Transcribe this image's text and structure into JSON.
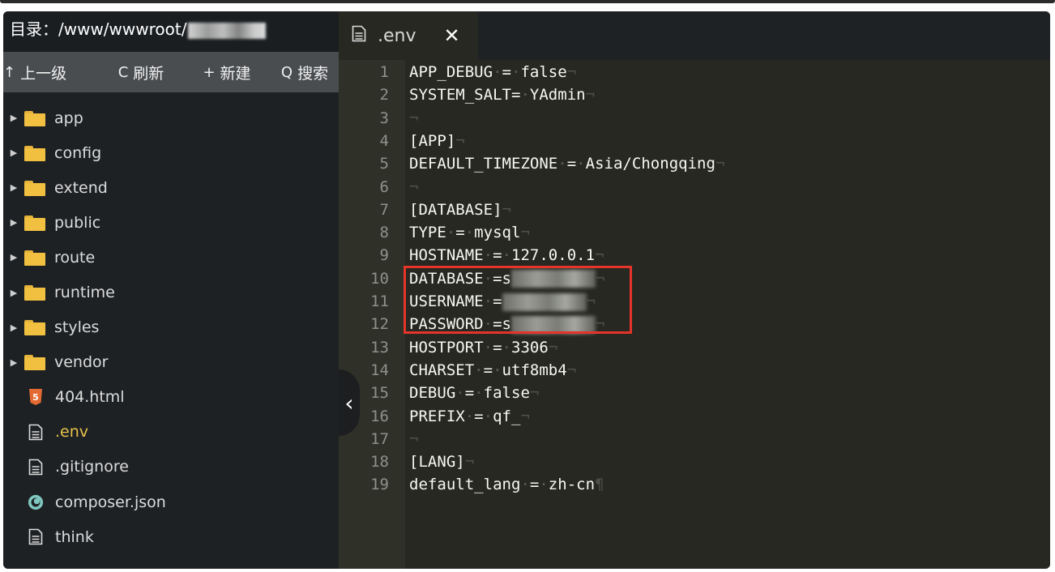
{
  "sidebar": {
    "directory_label": "目录：/www/wwwroot/",
    "toolbar": [
      {
        "icon": "arrow-up-icon",
        "glyph": "↑",
        "label": "上一级"
      },
      {
        "icon": "refresh-icon",
        "glyph": "C",
        "label": "刷新"
      },
      {
        "icon": "plus-icon",
        "glyph": "+",
        "label": "新建"
      },
      {
        "icon": "search-icon",
        "glyph": "Q",
        "label": "搜索"
      }
    ],
    "tree": {
      "folders": [
        "app",
        "config",
        "extend",
        "public",
        "route",
        "runtime",
        "styles",
        "vendor"
      ],
      "files": [
        {
          "name": "404.html",
          "icon": "html5-icon"
        },
        {
          "name": ".env",
          "icon": "document-icon",
          "active": true
        },
        {
          "name": ".gitignore",
          "icon": "document-icon"
        },
        {
          "name": "composer.json",
          "icon": "composer-icon"
        },
        {
          "name": "think",
          "icon": "document-icon"
        }
      ]
    }
  },
  "editor": {
    "tab": {
      "label": ".env",
      "close": "✕"
    },
    "lines": [
      {
        "n": "1",
        "text": "APP_DEBUG = false"
      },
      {
        "n": "2",
        "text": "SYSTEM_SALT= YAdmin"
      },
      {
        "n": "3",
        "text": ""
      },
      {
        "n": "4",
        "text": "[APP]"
      },
      {
        "n": "5",
        "text": "DEFAULT_TIMEZONE = Asia/Chongqing"
      },
      {
        "n": "6",
        "text": ""
      },
      {
        "n": "7",
        "text": "[DATABASE]"
      },
      {
        "n": "8",
        "text": "TYPE = mysql"
      },
      {
        "n": "9",
        "text": "HOSTNAME = 127.0.0.1"
      },
      {
        "n": "10",
        "text": "DATABASE =s"
      },
      {
        "n": "11",
        "text": "USERNAME ="
      },
      {
        "n": "12",
        "text": "PASSWORD =s"
      },
      {
        "n": "13",
        "text": "HOSTPORT = 3306"
      },
      {
        "n": "14",
        "text": "CHARSET = utf8mb4"
      },
      {
        "n": "15",
        "text": "DEBUG = false"
      },
      {
        "n": "16",
        "text": "PREFIX = qf_"
      },
      {
        "n": "17",
        "text": ""
      },
      {
        "n": "18",
        "text": "[LANG]"
      },
      {
        "n": "19",
        "text": "default_lang = zh-cn"
      }
    ],
    "colors": {
      "highlight": "#e5342a",
      "active_file": "#e6c34a",
      "folder": "#f2c040"
    }
  }
}
